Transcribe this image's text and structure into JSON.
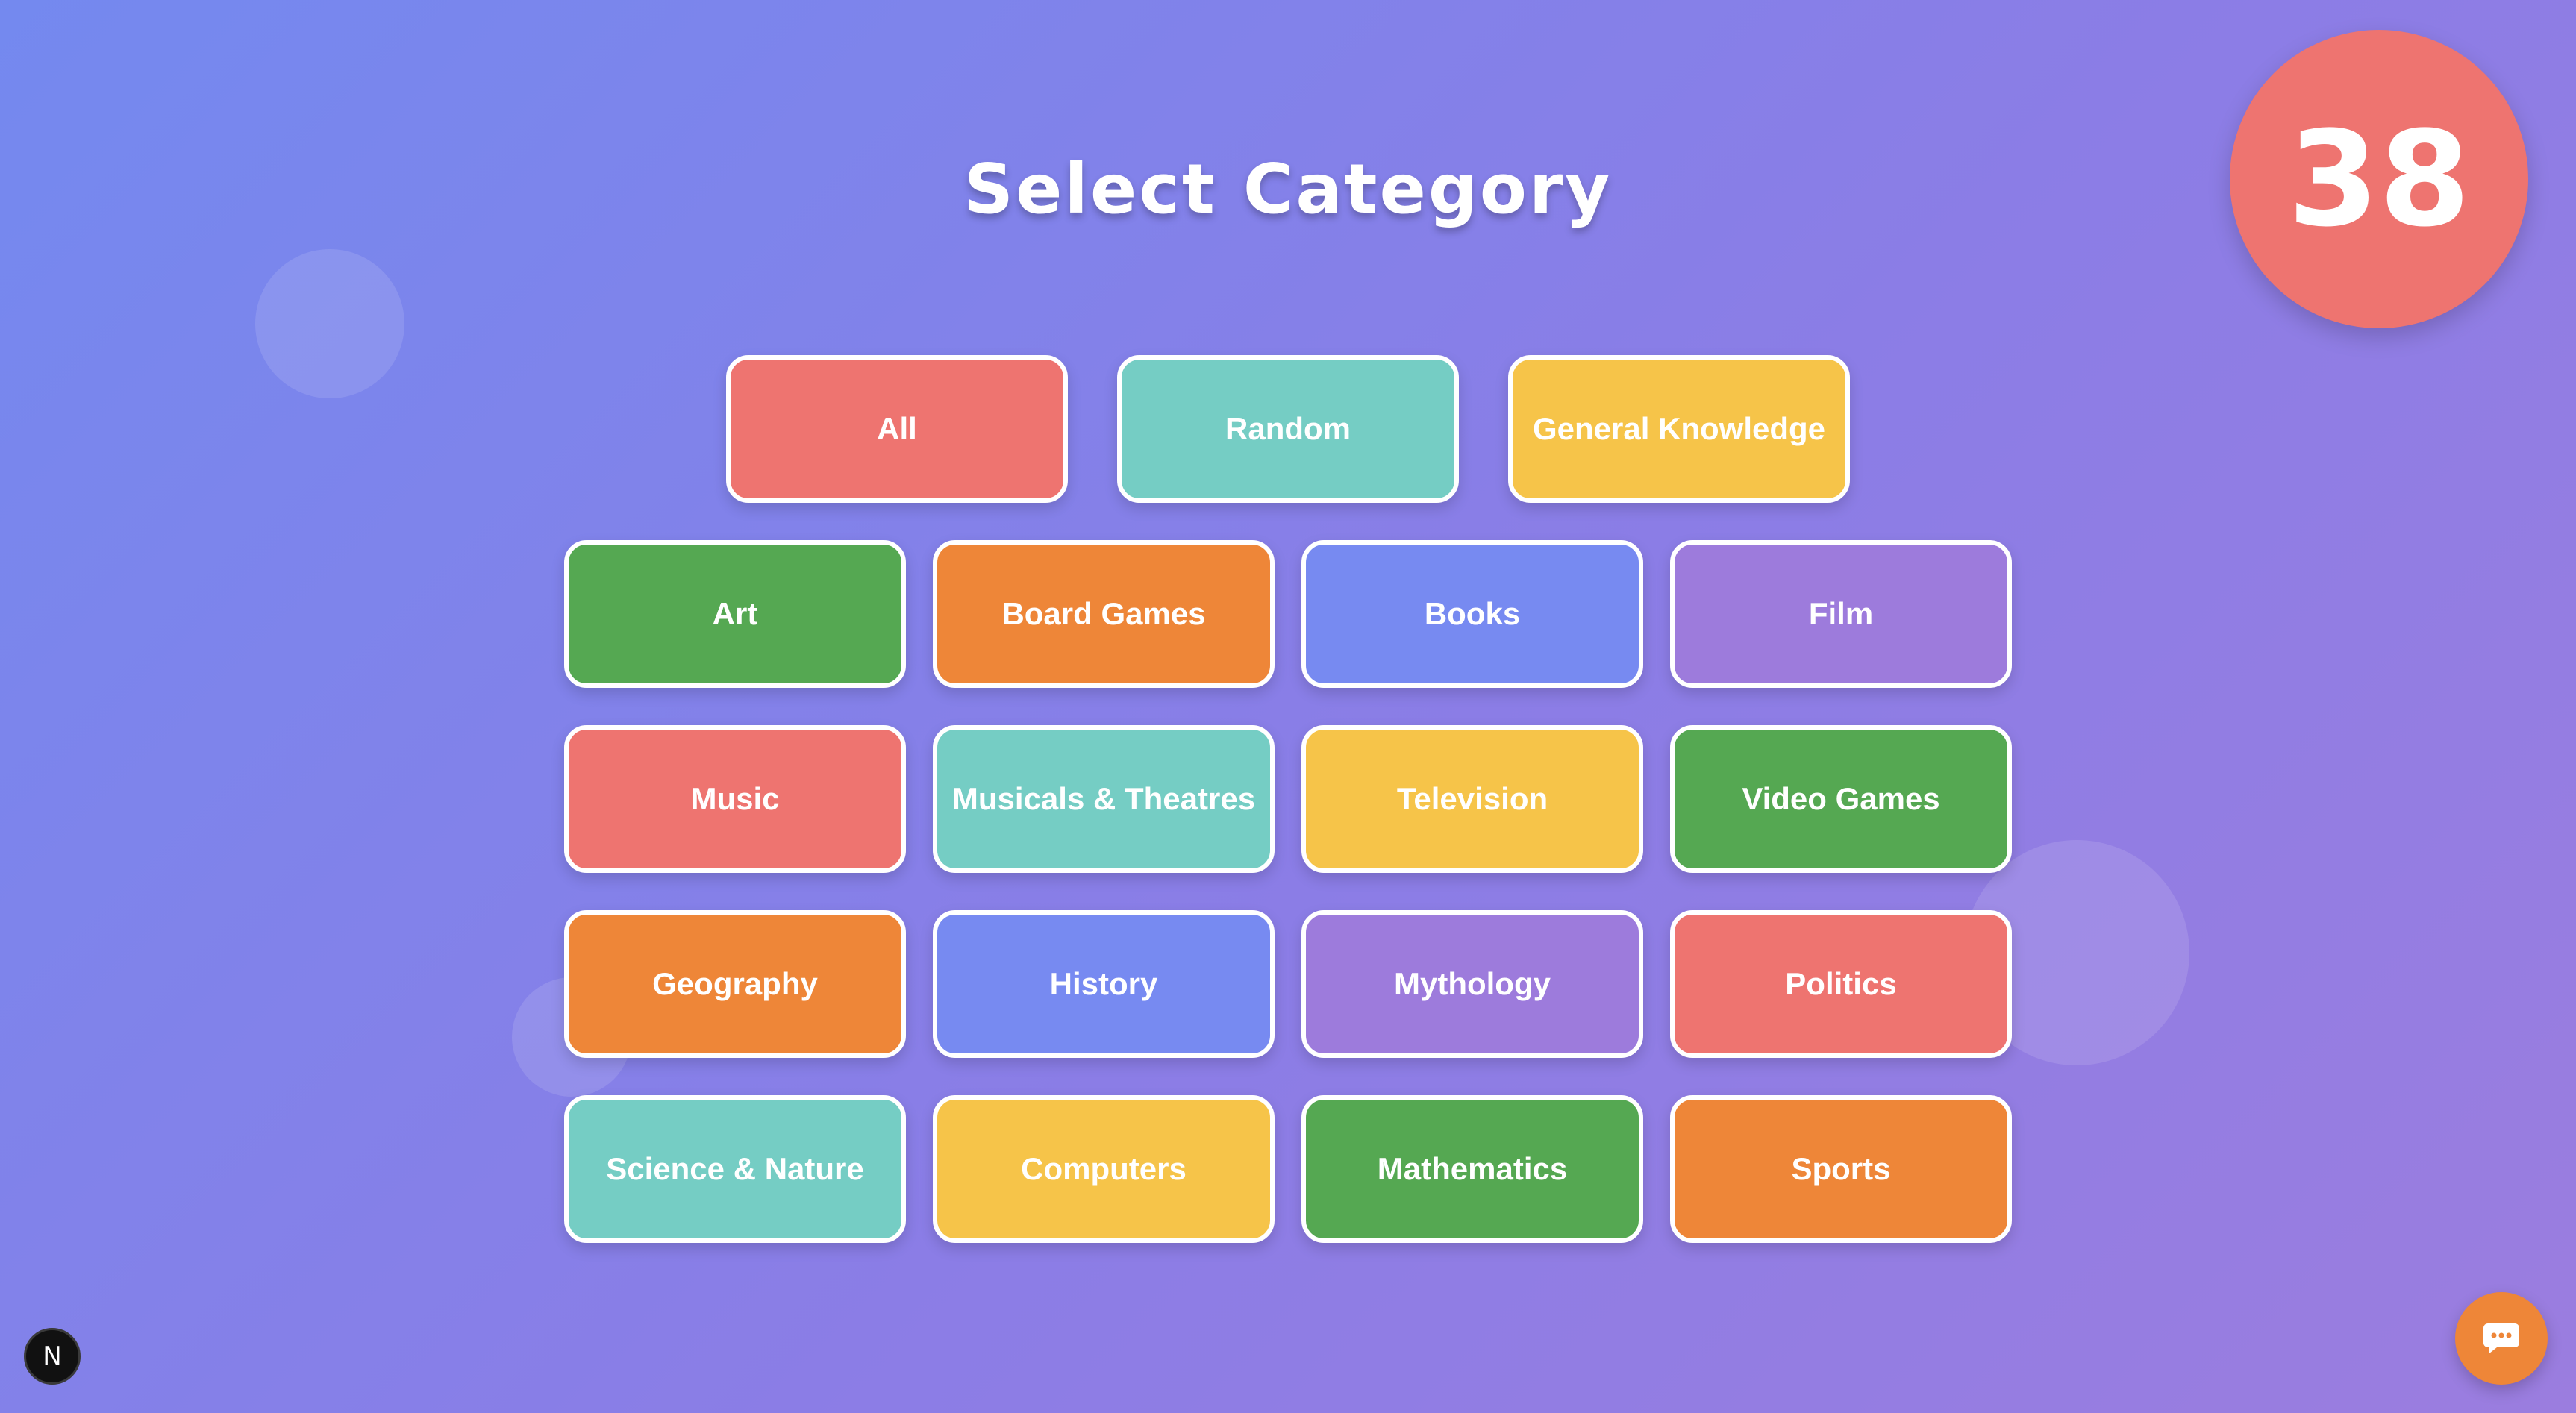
{
  "page": {
    "title": "Select Category"
  },
  "timer": {
    "value": "38",
    "color": "#ee7470"
  },
  "colors": {
    "red": "#ee7470",
    "teal": "#75cdc4",
    "yellow": "#f6c449",
    "green": "#55a852",
    "orange": "#ee8638",
    "blue": "#778af1",
    "purple": "#9d7bdc"
  },
  "top_categories": [
    {
      "label": "All",
      "color": "#ee7470"
    },
    {
      "label": "Random",
      "color": "#75cdc4"
    },
    {
      "label": "General Knowledge",
      "color": "#f6c449"
    }
  ],
  "category_rows": [
    [
      {
        "label": "Art",
        "color": "#55a852"
      },
      {
        "label": "Board Games",
        "color": "#ee8638"
      },
      {
        "label": "Books",
        "color": "#778af1"
      },
      {
        "label": "Film",
        "color": "#9d7bdc"
      }
    ],
    [
      {
        "label": "Music",
        "color": "#ee7470"
      },
      {
        "label": "Musicals & Theatres",
        "color": "#75cdc4"
      },
      {
        "label": "Television",
        "color": "#f6c449"
      },
      {
        "label": "Video Games",
        "color": "#55a852"
      }
    ],
    [
      {
        "label": "Geography",
        "color": "#ee8638"
      },
      {
        "label": "History",
        "color": "#778af1"
      },
      {
        "label": "Mythology",
        "color": "#9d7bdc"
      },
      {
        "label": "Politics",
        "color": "#ee7470"
      }
    ],
    [
      {
        "label": "Science & Nature",
        "color": "#75cdc4"
      },
      {
        "label": "Computers",
        "color": "#f6c449"
      },
      {
        "label": "Mathematics",
        "color": "#55a852"
      },
      {
        "label": "Sports",
        "color": "#ee8638"
      }
    ]
  ],
  "footer": {
    "badge_letter": "N",
    "badge_icon": "nextjs-logo-icon",
    "chat_icon": "chat-bubble-icon",
    "chat_color": "#ee8638"
  }
}
